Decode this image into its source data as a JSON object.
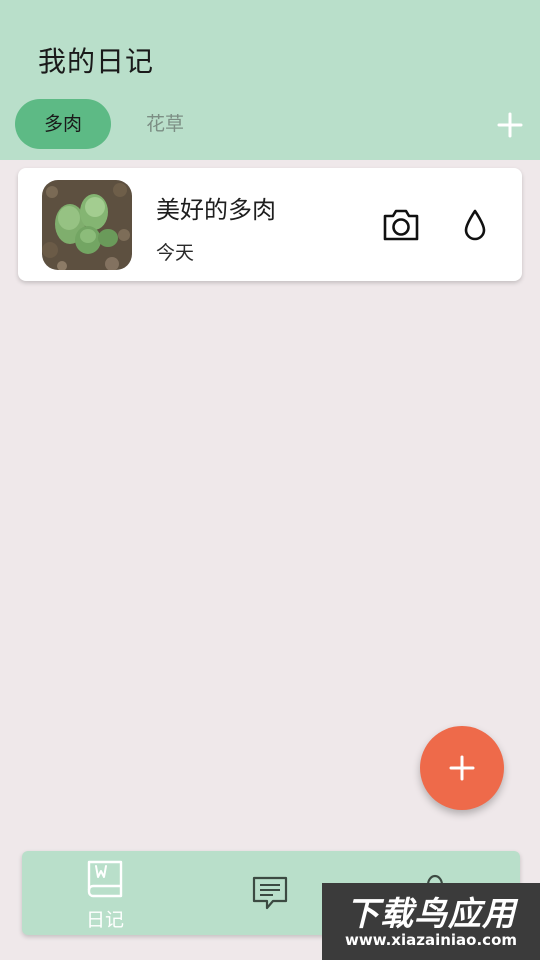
{
  "header": {
    "title": "我的日记",
    "tabs": [
      {
        "label": "多肉",
        "active": true
      },
      {
        "label": "花草",
        "active": false
      }
    ],
    "add_tab_icon": "plus-icon"
  },
  "diary_list": [
    {
      "title": "美好的多肉",
      "date": "今天",
      "thumbnail": "succulent-photo",
      "actions": [
        "camera-icon",
        "water-drop-icon"
      ]
    }
  ],
  "fab": {
    "icon": "plus-icon"
  },
  "bottom_nav": {
    "items": [
      {
        "label": "日记",
        "icon": "book-icon",
        "active": true
      },
      {
        "label": "",
        "icon": "chat-icon",
        "active": false
      },
      {
        "label": "",
        "icon": "user-icon",
        "active": false
      }
    ]
  },
  "watermark": {
    "title": "下载鸟应用",
    "url": "www.xiazainiao.com"
  },
  "colors": {
    "header_bg": "#b9dfca",
    "active_tab": "#5dba85",
    "page_bg": "#efe8ea",
    "fab": "#ee6a4a"
  }
}
